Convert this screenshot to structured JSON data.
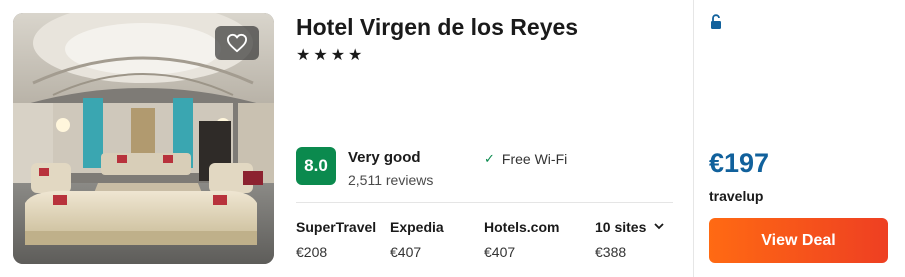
{
  "hotel": {
    "name": "Hotel Virgen de los Reyes",
    "stars": "★★★★",
    "star_count": 4
  },
  "rating": {
    "score": "8.0",
    "label": "Very good",
    "reviews": "2,511 reviews"
  },
  "amenities": [
    {
      "icon": "check-icon",
      "label": "Free Wi-Fi"
    }
  ],
  "prices": [
    {
      "site": "SuperTravel",
      "price": "€208"
    },
    {
      "site": "Expedia",
      "price": "€407"
    },
    {
      "site": "Hotels.com",
      "price": "€407"
    },
    {
      "site": "10 sites",
      "price": "€388",
      "expandable": true
    }
  ],
  "deal": {
    "price": "€197",
    "provider": "travelup",
    "button_label": "View Deal",
    "lock_icon": "lock-open-icon"
  },
  "icons": {
    "favorite": "heart-icon",
    "expand": "chevron-down-icon"
  },
  "colors": {
    "score_bg": "#0b8a4e",
    "price": "#11619c",
    "button_start": "#ff6a13",
    "button_end": "#ee3f22",
    "lock": "#11619c"
  }
}
